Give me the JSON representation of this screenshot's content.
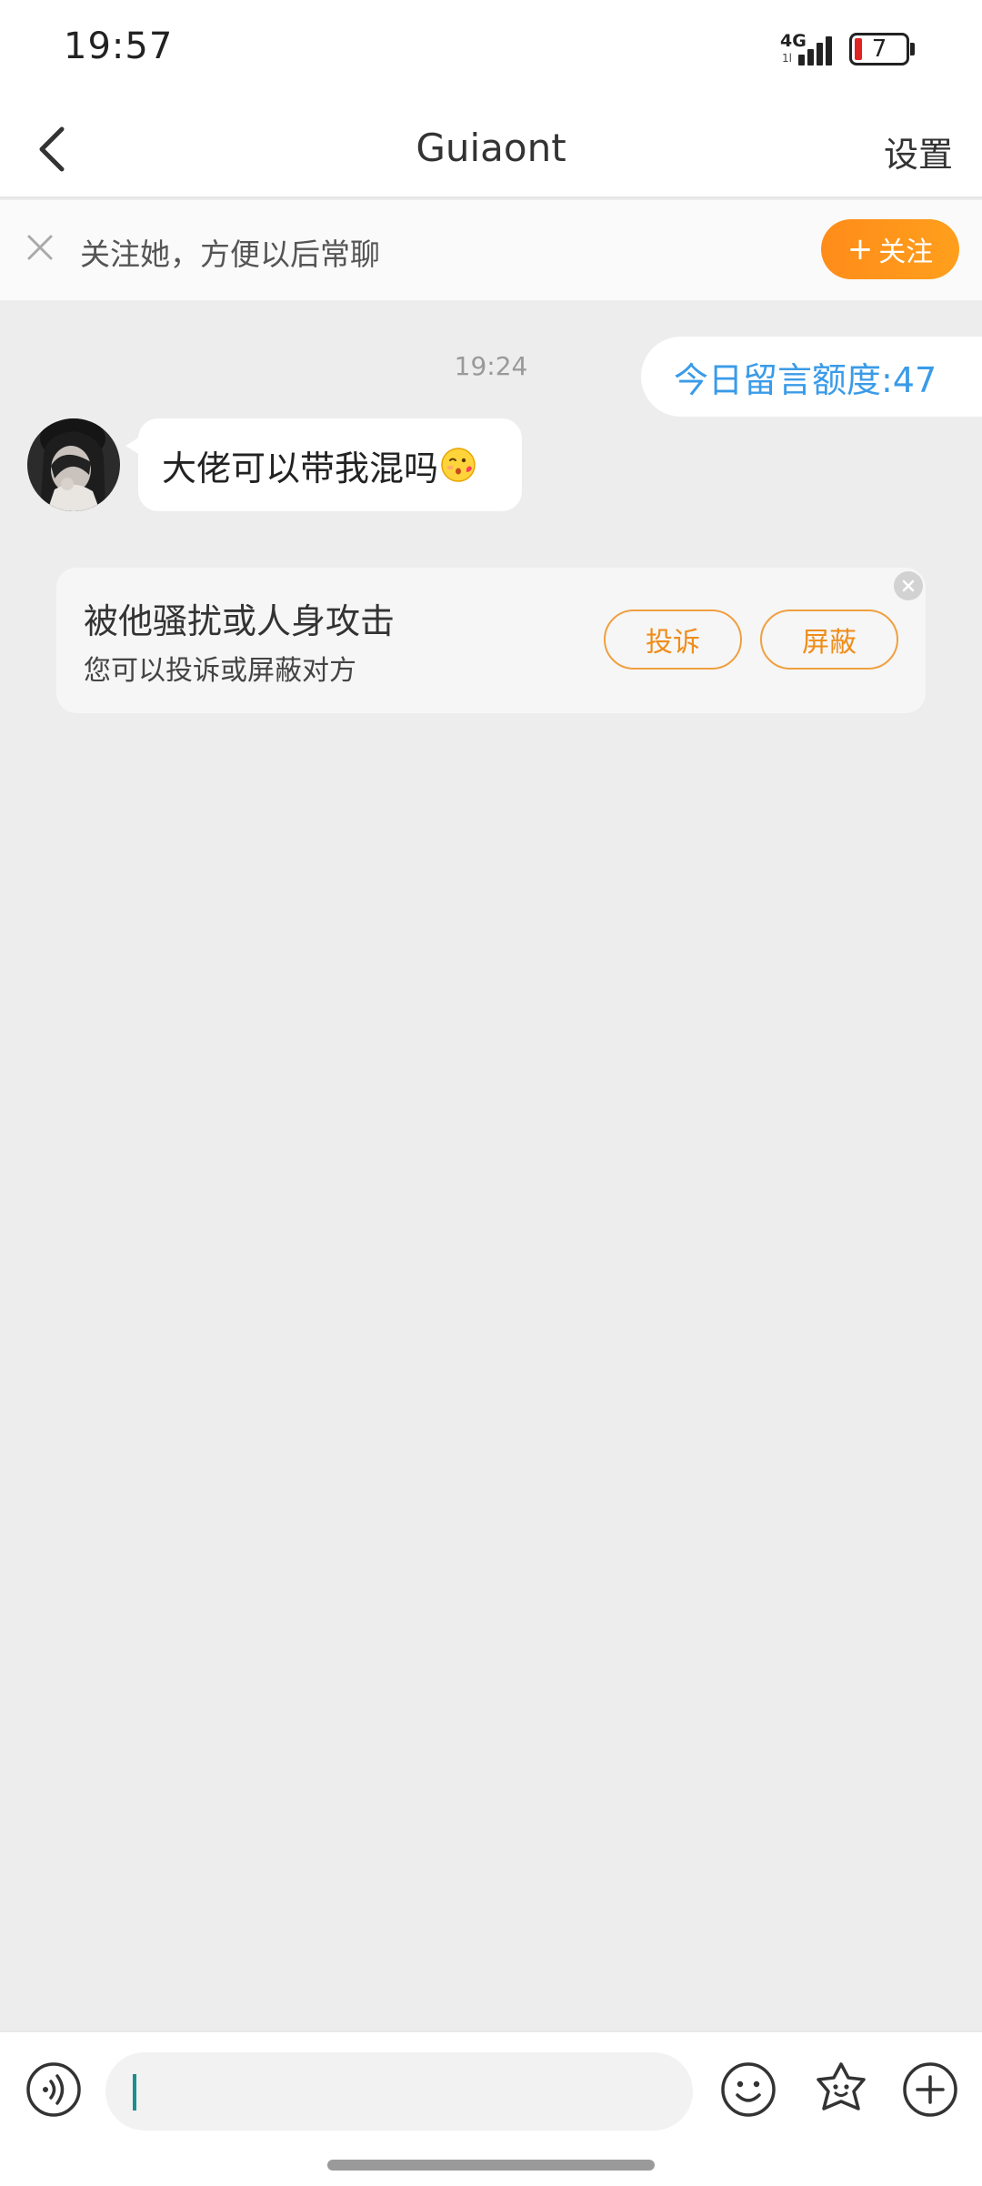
{
  "status_bar": {
    "time": "19:57",
    "network": "4G",
    "network_sub": "1l",
    "battery_level": "7",
    "signal_icon": "signal-bars-icon",
    "battery_color": "#e02424"
  },
  "header": {
    "back_icon": "chevron-left-icon",
    "title": "Guiaont",
    "settings_label": "设置"
  },
  "follow_bar": {
    "close_icon": "close-icon",
    "text": "关注她，方便以后常聊",
    "button_plus": "+",
    "button_label": "关注",
    "button_color": "#ff8c1a"
  },
  "chat": {
    "timestamp": "19:24",
    "quota_text": "今日留言额度:47",
    "quota_color": "#3a9be8",
    "incoming_message": {
      "text": "大佬可以带我混吗",
      "emoji": "kiss-face-emoji"
    },
    "report_card": {
      "title": "被他骚扰或人身攻击",
      "subtitle": "您可以投诉或屏蔽对方",
      "complain_label": "投诉",
      "block_label": "屏蔽",
      "accent_color": "#ef8d1b"
    }
  },
  "input_bar": {
    "voice_icon": "voice-icon",
    "input_value": "",
    "emoji_icon": "smile-icon",
    "sticker_icon": "sticker-icon",
    "more_icon": "plus-circle-icon"
  }
}
